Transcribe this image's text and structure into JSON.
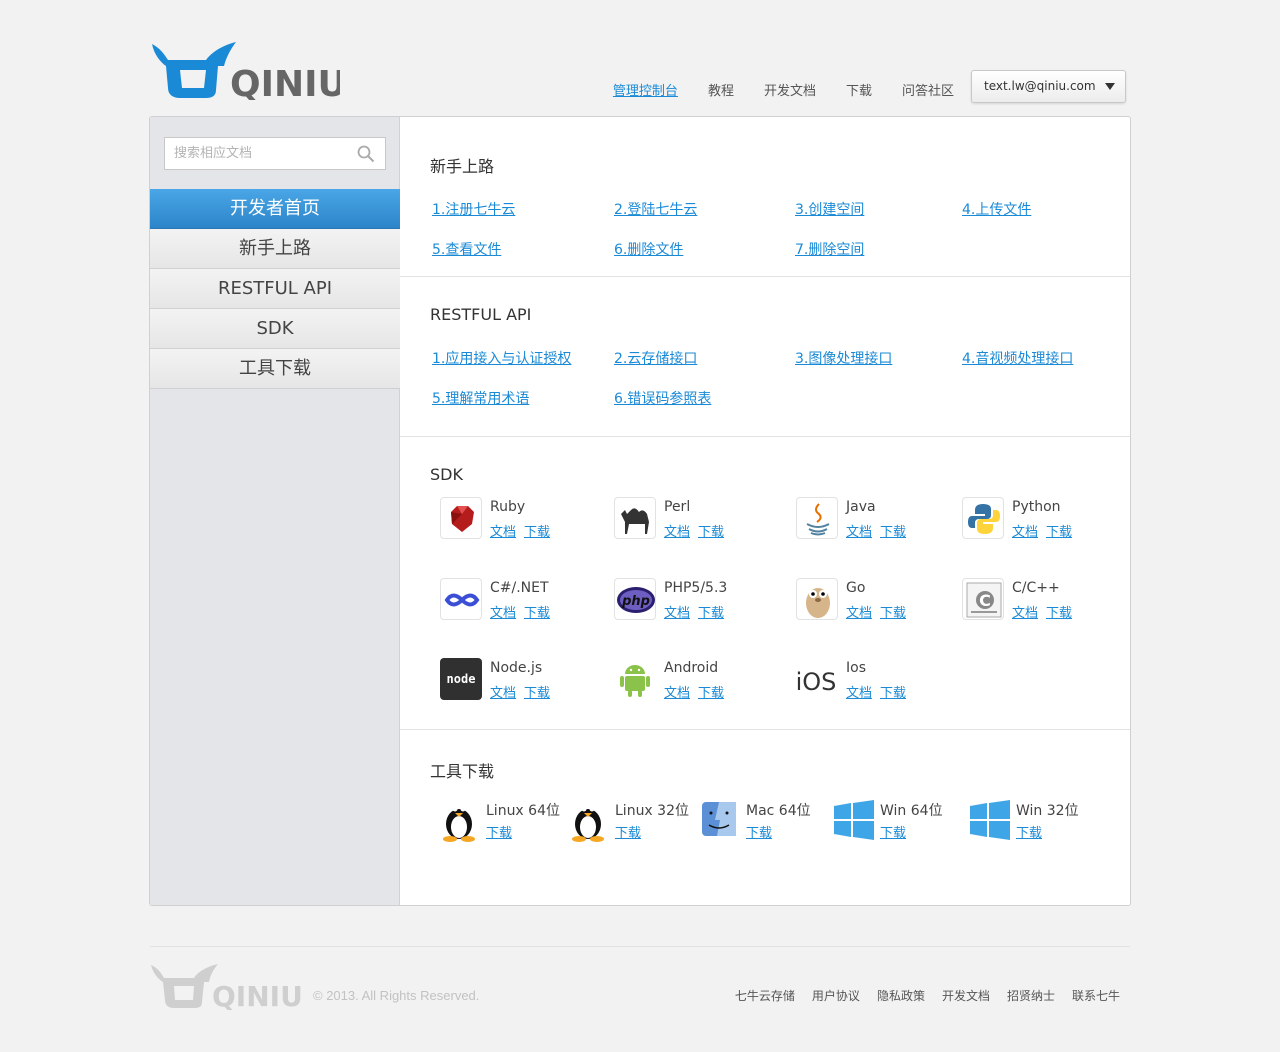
{
  "header": {
    "logo_text": "QINIU",
    "nav": [
      "管理控制台",
      "教程",
      "开发文档",
      "下载",
      "问答社区"
    ],
    "user_email": "text.lw@qiniu.com"
  },
  "sidebar": {
    "search_placeholder": "搜索相应文档",
    "items": [
      "开发者首页",
      "新手上路",
      "RESTFUL API",
      "SDK",
      "工具下载"
    ]
  },
  "sections": {
    "getting_started": {
      "title": "新手上路",
      "links": [
        "1.注册七牛云",
        "2.登陆七牛云",
        "3.创建空间",
        "4.上传文件",
        "5.查看文件",
        "6.删除文件",
        "7.删除空间"
      ]
    },
    "restful": {
      "title": "RESTFUL API",
      "links": [
        "1.应用接入与认证授权",
        "2.云存储接口",
        "3.图像处理接口",
        "4.音视频处理接口",
        "5.理解常用术语",
        "6.错误码参照表"
      ]
    },
    "sdk": {
      "title": "SDK",
      "doc_label": "文档",
      "download_label": "下载",
      "items": [
        {
          "name": "Ruby",
          "icon": "ruby-icon"
        },
        {
          "name": "Perl",
          "icon": "camel-icon"
        },
        {
          "name": "Java",
          "icon": "java-icon"
        },
        {
          "name": "Python",
          "icon": "python-icon"
        },
        {
          "name": "C#/.NET",
          "icon": "visual-studio-icon"
        },
        {
          "name": "PHP5/5.3",
          "icon": "php-icon"
        },
        {
          "name": "Go",
          "icon": "gopher-icon"
        },
        {
          "name": "C/C++",
          "icon": "c-book-icon"
        },
        {
          "name": "Node.js",
          "icon": "nodejs-icon"
        },
        {
          "name": "Android",
          "icon": "android-icon"
        },
        {
          "name": "Ios",
          "icon": "ios-icon"
        }
      ],
      "node_logo_text": "node",
      "ios_logo_text": "iOS",
      "php_logo_text": "php",
      "c_book_text": "C"
    },
    "tools": {
      "title": "工具下载",
      "download_label": "下载",
      "items": [
        {
          "name": "Linux 64位",
          "icon": "linux-penguin-icon"
        },
        {
          "name": "Linux 32位",
          "icon": "linux-penguin-icon"
        },
        {
          "name": "Mac 64位",
          "icon": "mac-finder-icon"
        },
        {
          "name": "Win 64位",
          "icon": "windows-icon"
        },
        {
          "name": "Win 32位",
          "icon": "windows-icon"
        }
      ]
    }
  },
  "footer": {
    "logo_text": "QINIU",
    "copyright": "© 2013. All Rights Reserved.",
    "links": [
      "七牛云存储",
      "用户协议",
      "隐私政策",
      "开发文档",
      "招贤纳士",
      "联系七牛"
    ]
  },
  "colors": {
    "accent": "#1b8ad6",
    "active_nav": "#2c85c9",
    "logo_blue": "#1b8ad6",
    "logo_gray": "#666666"
  }
}
